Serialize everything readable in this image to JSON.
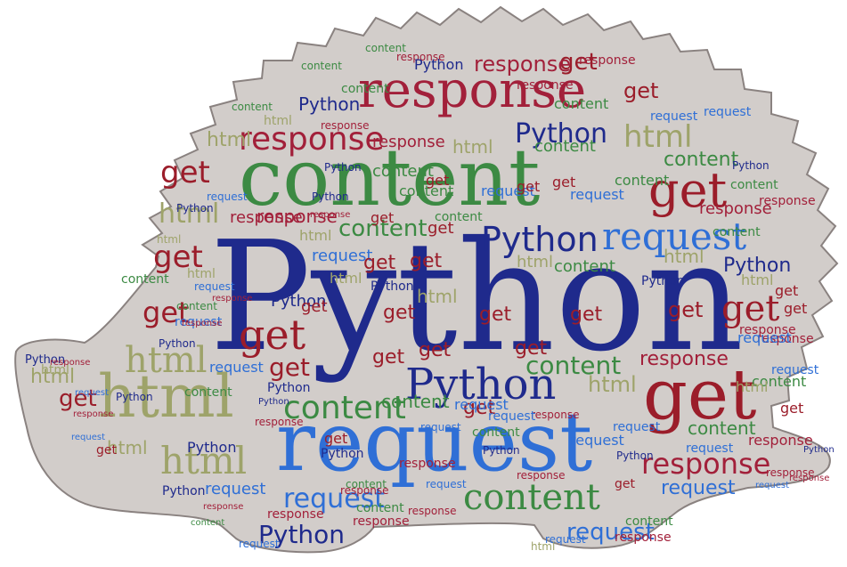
{
  "colors": {
    "background": "#ffffff",
    "silhouette": "#d2cdca",
    "silhouette_edge": "#8a8280",
    "navy": "#1f2a8c",
    "blue": "#2f6fd6",
    "red": "#a2203a",
    "green": "#3c8a43",
    "olive": "#9ea36a",
    "dark_red": "#9b1d2a"
  },
  "words": {
    "python": "Python",
    "request": "request",
    "content": "content",
    "response": "response",
    "get": "get",
    "html": "html"
  }
}
